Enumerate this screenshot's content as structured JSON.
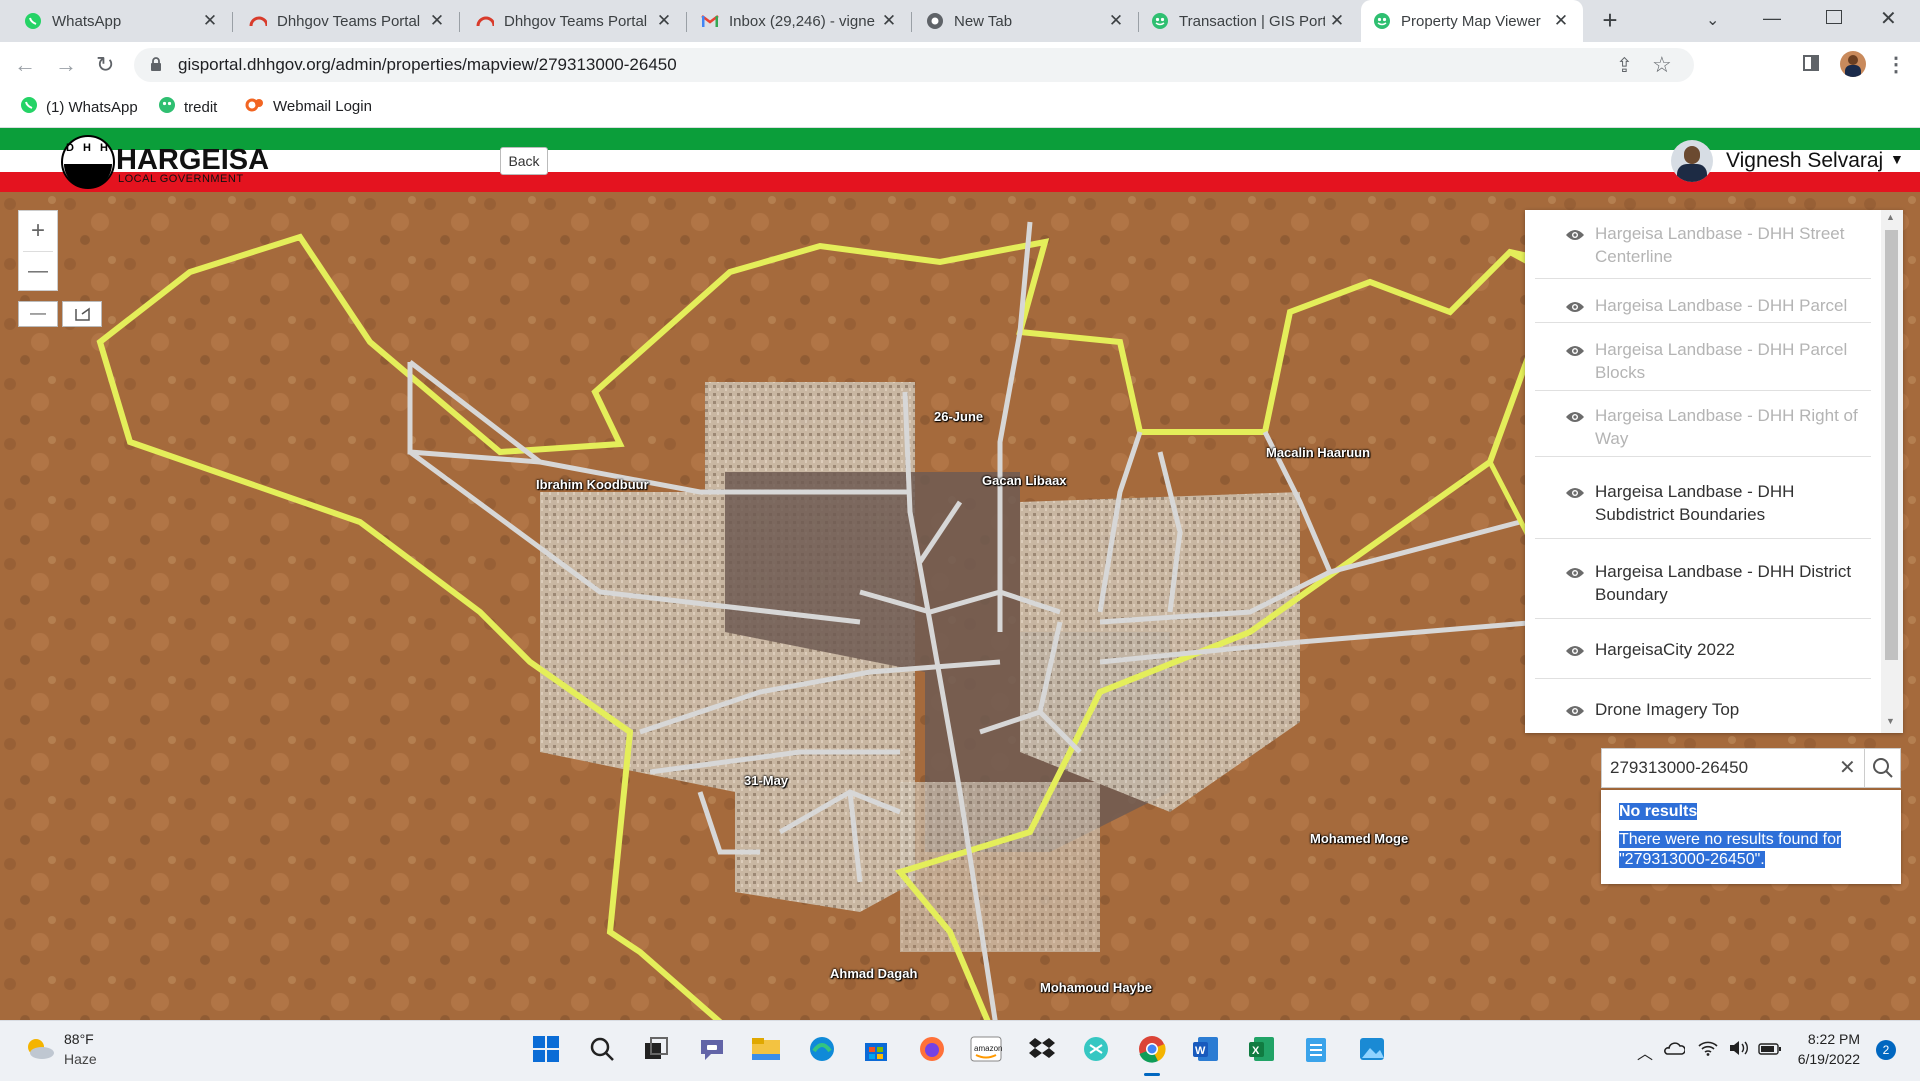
{
  "browser": {
    "tabs": [
      {
        "title": "WhatsApp",
        "icon": "whatsapp-icon"
      },
      {
        "title": "Dhhgov Teams Portal",
        "icon": "teams-portal-icon"
      },
      {
        "title": "Dhhgov Teams Portal",
        "icon": "teams-portal-icon"
      },
      {
        "title": "Inbox (29,246) - vigne",
        "icon": "gmail-icon"
      },
      {
        "title": "New Tab",
        "icon": "chrome-icon"
      },
      {
        "title": "Transaction | GIS Port",
        "icon": "portal-icon"
      },
      {
        "title": "Property Map Viewer",
        "icon": "portal-icon",
        "active": true
      }
    ],
    "url": "gisportal.dhhgov.org/admin/properties/mapview/279313000-26450",
    "bookmarks": [
      {
        "label": "(1) WhatsApp",
        "icon": "whatsapp-icon"
      },
      {
        "label": "tredit",
        "icon": "tredit-icon"
      },
      {
        "label": "Webmail Login",
        "icon": "webmail-icon"
      }
    ]
  },
  "header": {
    "logo_initials": "D H H",
    "logo_title": "HARGEISA",
    "logo_subtitle": "LOCAL GOVERNMENT",
    "back_label": "Back",
    "user_name": "Vignesh Selvaraj",
    "colors": {
      "green": "#0b9e3a",
      "red": "#e4131f"
    }
  },
  "map": {
    "zoom_in": "+",
    "zoom_out": "—",
    "labels": [
      "26-June",
      "Ibrahim Koodbuur",
      "Gacan Libaax",
      "Macalin Haaruun",
      "31-May",
      "Mohamed Moge",
      "Ahmad Dagah",
      "Mohamoud Haybe"
    ]
  },
  "layers": [
    {
      "label": "Hargeisa Landbase - DHH Street Centerline",
      "visible": false
    },
    {
      "label": "Hargeisa Landbase - DHH Parcel",
      "visible": false
    },
    {
      "label": "Hargeisa Landbase - DHH Parcel Blocks",
      "visible": false
    },
    {
      "label": "Hargeisa Landbase - DHH Right of Way",
      "visible": false
    },
    {
      "label": "Hargeisa Landbase - DHH Subdistrict Boundaries",
      "visible": true
    },
    {
      "label": "Hargeisa Landbase - DHH District Boundary",
      "visible": true
    },
    {
      "label": "HargeisaCity 2022",
      "visible": true
    },
    {
      "label": "Drone Imagery Top",
      "visible": true
    }
  ],
  "search": {
    "value": "279313000-26450",
    "result_title": "No results",
    "result_message_line1": "There were no results found for",
    "result_message_line2": "\"279313000-26450\"."
  },
  "taskbar": {
    "weather_temp": "88°F",
    "weather_desc": "Haze",
    "time": "8:22 PM",
    "date": "6/19/2022",
    "notifications": "2"
  }
}
